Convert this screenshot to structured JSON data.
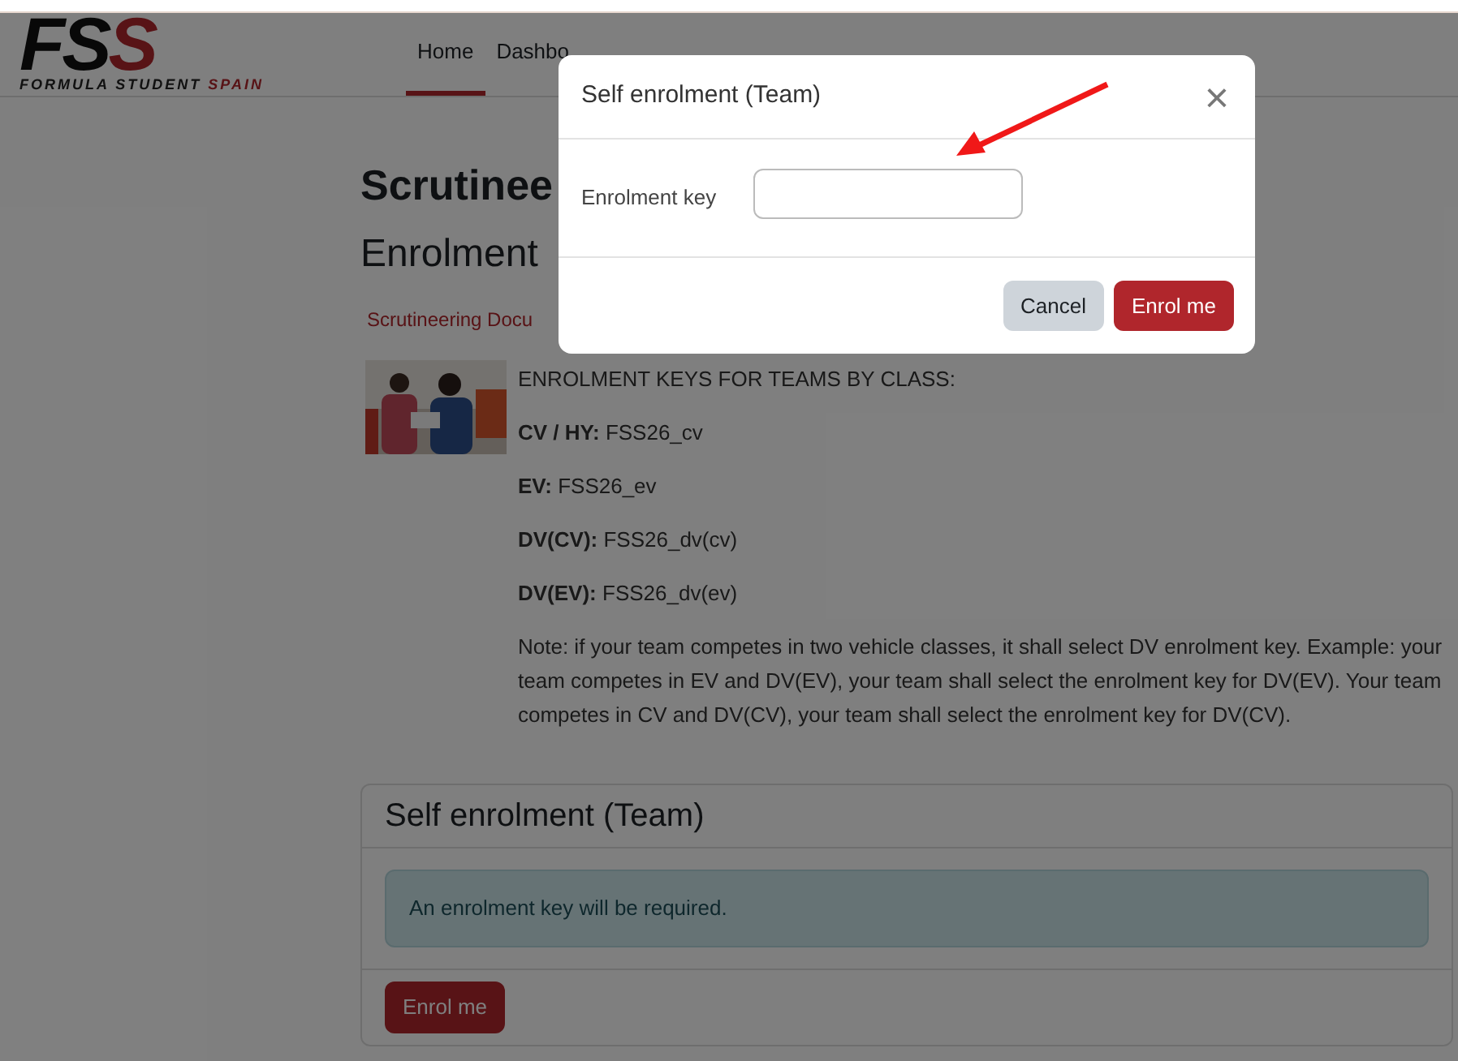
{
  "logo": {
    "mark": [
      "FS",
      "S"
    ],
    "tagline": [
      "FORMULA STUDENT",
      "SPAIN"
    ]
  },
  "nav": [
    {
      "label": "Home",
      "selected": true
    },
    {
      "label": "Dashbo",
      "selected": false
    }
  ],
  "page": {
    "title": "Scrutinee",
    "subtitle": "Enrolment",
    "link": "Scrutineering Docu",
    "intro": "ENROLMENT KEYS FOR TEAMS BY CLASS:",
    "keys": [
      "**CV / HY:** FSS26_cv",
      "**EV:** FSS26_ev",
      "**DV(CV):** FSS26_dv(cv)",
      "**DV(EV):** FSS26_dv(ev)"
    ],
    "note": "Note: if your team competes in two vehicle classes, it shall select DV enrolment key. Example: your team competes in EV and DV(EV), your team shall select the enrolment key for DV(EV). Your team competes in CV and DV(CV), your team shall select the enrolment key for DV(CV)."
  },
  "card": {
    "title": "Self enrolment (Team)",
    "alert": "An enrolment key will be required.",
    "button": "Enrol me"
  },
  "modal": {
    "title": "Self enrolment (Team)",
    "close": "×",
    "field_label": "Enrolment key",
    "buttons": [
      {
        "label": "Cancel",
        "kind": "secondary"
      },
      {
        "label": "Enrol me",
        "kind": "primary"
      }
    ]
  }
}
